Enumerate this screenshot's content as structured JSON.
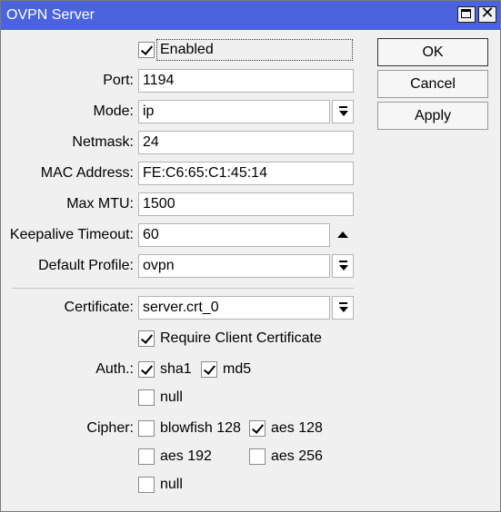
{
  "window": {
    "title": "OVPN Server"
  },
  "form": {
    "enabled_label": "Enabled",
    "port_label": "Port:",
    "port_value": "1194",
    "mode_label": "Mode:",
    "mode_value": "ip",
    "netmask_label": "Netmask:",
    "netmask_value": "24",
    "mac_label": "MAC Address:",
    "mac_value": "FE:C6:65:C1:45:14",
    "mtu_label": "Max MTU:",
    "mtu_value": "1500",
    "keepalive_label": "Keepalive Timeout:",
    "keepalive_value": "60",
    "profile_label": "Default Profile:",
    "profile_value": "ovpn",
    "certificate_label": "Certificate:",
    "certificate_value": "server.crt_0",
    "require_cert_label": "Require Client Certificate",
    "auth_label": "Auth.:",
    "auth_sha1": "sha1",
    "auth_md5": "md5",
    "auth_null": "null",
    "cipher_label": "Cipher:",
    "cipher_blowfish": "blowfish 128",
    "cipher_aes128": "aes 128",
    "cipher_aes192": "aes 192",
    "cipher_aes256": "aes 256",
    "cipher_null": "null"
  },
  "buttons": {
    "ok": "OK",
    "cancel": "Cancel",
    "apply": "Apply"
  },
  "colors": {
    "titlebar": "#4b64de",
    "background": "#f0f0f0"
  }
}
